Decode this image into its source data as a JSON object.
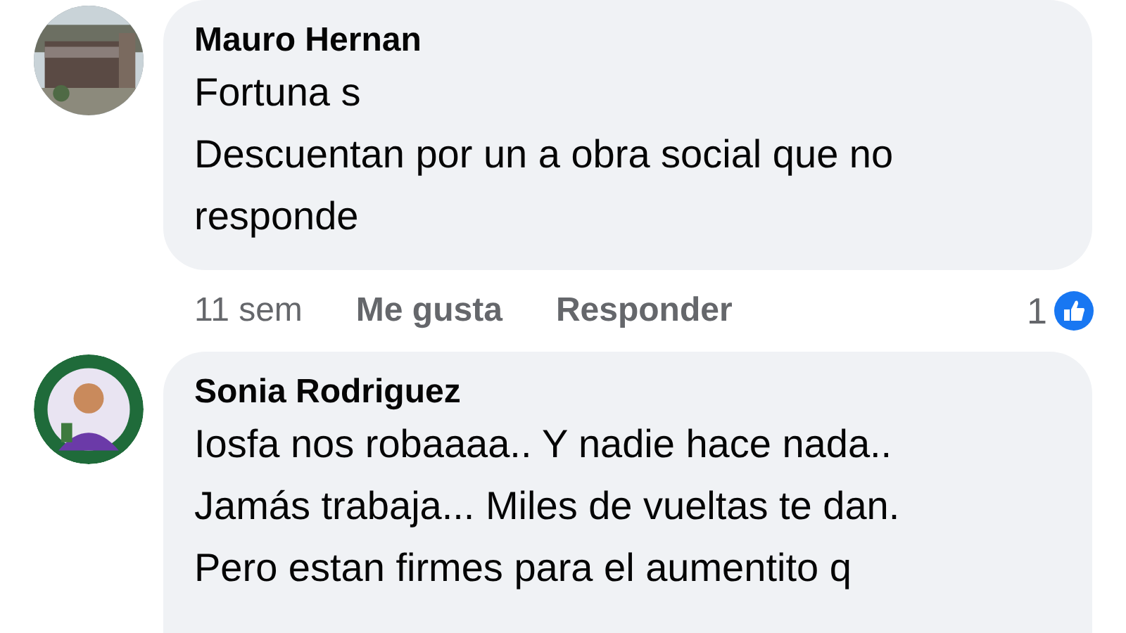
{
  "comments": [
    {
      "author": "Mauro Hernan",
      "text": "Fortuna s\nDescuentan por un a obra social que no\nresponde",
      "actions": {
        "time": "11 sem",
        "like": "Me gusta",
        "reply": "Responder",
        "reactions": "1"
      }
    },
    {
      "author": "Sonia Rodriguez",
      "text": "Iosfa nos robaaaa.. Y nadie hace nada..\nJamás trabaja... Miles de vueltas te dan.\nPero estan firmes para el aumentito q"
    }
  ]
}
